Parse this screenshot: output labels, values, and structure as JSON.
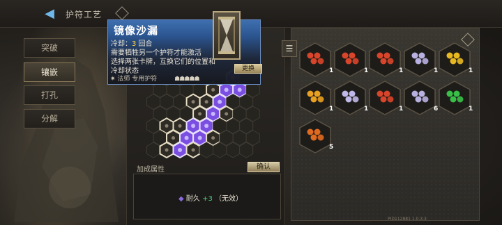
{
  "header": {
    "title": "护符工艺"
  },
  "tabs": [
    {
      "label": "突破",
      "active": false
    },
    {
      "label": "镶嵌",
      "active": true
    },
    {
      "label": "打孔",
      "active": false
    },
    {
      "label": "分解",
      "active": false
    }
  ],
  "tooltip": {
    "title": "镜像沙漏",
    "cooldown_label": "冷却：",
    "cooldown_value": "3",
    "cooldown_unit": " 回合",
    "desc_lines": [
      "需要牺牲另一个护符才能激活",
      "选择两张卡牌，互换它们的位置和",
      "冷却状态"
    ],
    "class_label": "法师 专用护符",
    "swap_button": "更换"
  },
  "bonus": {
    "header": "加成属性",
    "confirm_button": "确认",
    "stat_name": "耐久",
    "stat_value": "+3",
    "stat_note": "（无效）"
  },
  "inventory": {
    "items": [
      {
        "color": "#d8452a",
        "count": "1"
      },
      {
        "color": "#d8452a",
        "count": "1"
      },
      {
        "color": "#d8452a",
        "count": "1"
      },
      {
        "color": "#b8b0e0",
        "count": "1"
      },
      {
        "color": "#e8b820",
        "count": "1"
      },
      {
        "color": "#e8a020",
        "count": "1"
      },
      {
        "color": "#c0b8e8",
        "count": "1"
      },
      {
        "color": "#d8452a",
        "count": "1"
      },
      {
        "color": "#b8b0e0",
        "count": "6"
      },
      {
        "color": "#38c048",
        "count": "1"
      },
      {
        "color": "#e06a20",
        "count": "5"
      }
    ]
  },
  "footer": {
    "build_id": "PID112881 1.0.3.3"
  },
  "colors": {
    "accent_blue": "#3f6fb0",
    "board_gem": "#7a4ee0",
    "stat_green": "#4ecf7a"
  }
}
